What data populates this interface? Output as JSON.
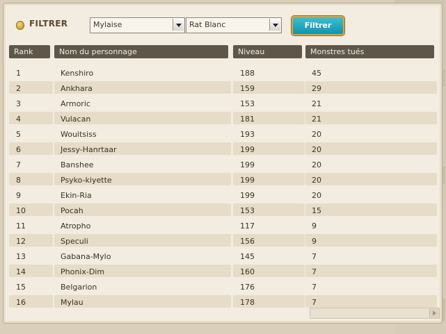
{
  "filter": {
    "label": "FILTRER",
    "select1_value": "Mylaise",
    "select2_value": "Rat Blanc",
    "button_label": "Filtrer"
  },
  "table": {
    "columns": [
      "Rank",
      "Nom du personnage",
      "Niveau",
      "Monstres tués"
    ],
    "rows": [
      {
        "rank": "1",
        "name": "Kenshiro",
        "level": "188",
        "kills": "45"
      },
      {
        "rank": "2",
        "name": "Ankhara",
        "level": "159",
        "kills": "29"
      },
      {
        "rank": "3",
        "name": "Armoric",
        "level": "153",
        "kills": "21"
      },
      {
        "rank": "4",
        "name": "Vulacan",
        "level": "181",
        "kills": "21"
      },
      {
        "rank": "5",
        "name": "Wouitsiss",
        "level": "193",
        "kills": "20"
      },
      {
        "rank": "6",
        "name": "Jessy-Hanrtaar",
        "level": "199",
        "kills": "20"
      },
      {
        "rank": "7",
        "name": "Banshee",
        "level": "199",
        "kills": "20"
      },
      {
        "rank": "8",
        "name": "Psyko-kiyette",
        "level": "199",
        "kills": "20"
      },
      {
        "rank": "9",
        "name": "Ekin-Ria",
        "level": "199",
        "kills": "20"
      },
      {
        "rank": "10",
        "name": "Pocah",
        "level": "153",
        "kills": "15"
      },
      {
        "rank": "11",
        "name": "Atropho",
        "level": "117",
        "kills": "9"
      },
      {
        "rank": "12",
        "name": "Speculi",
        "level": "156",
        "kills": "9"
      },
      {
        "rank": "13",
        "name": "Gabana-Mylo",
        "level": "145",
        "kills": "7"
      },
      {
        "rank": "14",
        "name": "Phonix-Dim",
        "level": "160",
        "kills": "7"
      },
      {
        "rank": "15",
        "name": "Belgarion",
        "level": "176",
        "kills": "7"
      },
      {
        "rank": "16",
        "name": "Mylau",
        "level": "178",
        "kills": "7"
      }
    ]
  },
  "colors": {
    "header_bg": "#5e5749",
    "button_bg": "#1ba6bb",
    "button_border": "#e3a23c",
    "panel_bg": "#f3ece0",
    "row_band": "#e6dcc7"
  },
  "icons": {
    "filter": "coin-icon",
    "dropdown": "chevron-down-icon",
    "scroll": "chevron-right-icon"
  }
}
